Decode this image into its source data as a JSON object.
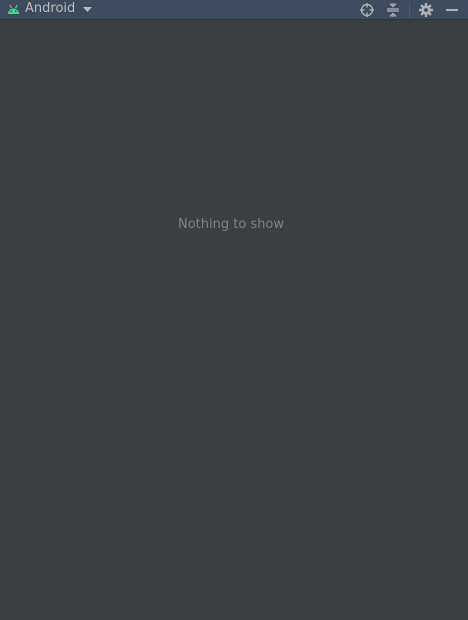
{
  "toolbar": {
    "view_mode_label": "Android",
    "icons": {
      "android": "android-icon",
      "dropdown": "chevron-down-icon",
      "locate": "crosshair-icon",
      "collapse": "collapse-all-icon",
      "settings": "gear-icon",
      "hide": "minimize-icon"
    }
  },
  "content": {
    "empty_message": "Nothing to show"
  },
  "colors": {
    "background": "#3c3f41",
    "toolbar": "#3d4b5c",
    "android_green": "#3ddc84",
    "text": "#bbbbbb",
    "muted_text": "#7e8185"
  }
}
